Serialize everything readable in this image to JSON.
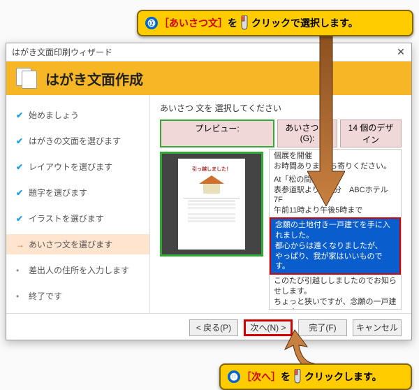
{
  "callouts": {
    "top_num": "⓾",
    "top_red": "［あいさつ文］",
    "top_mid": "を",
    "top_action": "クリック",
    "top_tail": "で選択します。",
    "bottom_num": "⓫",
    "bottom_red": "［次へ］",
    "bottom_mid": "を",
    "bottom_action": "クリック",
    "bottom_tail": "します。"
  },
  "dialog": {
    "title": "はがき文面印刷ウィザード",
    "banner_title": "はがき文面作成",
    "steps": [
      {
        "label": "始めましょう"
      },
      {
        "label": "はがきの文面を選びます"
      },
      {
        "label": "レイアウトを選びます"
      },
      {
        "label": "題字を選びます"
      },
      {
        "label": "イラストを選びます"
      },
      {
        "label": "あいさつ文を選びます"
      },
      {
        "label": "差出人の住所を入力します"
      },
      {
        "label": "終了です"
      }
    ],
    "instruction": "あいさつ 文を 選択してください",
    "headers": {
      "preview": "プレビュー:",
      "greeting": "あいさつ 文(G):",
      "design": "14 個のデザイン"
    },
    "preview_title": "引っ越しました！",
    "greet_items": [
      "個展を開催\nお時間ありま                  立ち寄りください。",
      "At「松の間」\n表参道駅より徒          3分　ABCホテル7F\n午前11時より午後5時まで",
      "念願の土地付き一戸建てを手に入れました。\n都心からは遠くなりましたが、\nやっぱり、我が家はいいものです。",
      "このたび引越ししましたのでお知らせします。\nちょっと狭いですが、念願の一戸建てです。\nお近くにお越しの際は、是非ともお立ち寄りください。"
    ],
    "buttons": {
      "back": "< 戻る(P)",
      "next": "次へ(N) >",
      "finish": "完了(F)",
      "cancel": "キャンセル"
    }
  }
}
